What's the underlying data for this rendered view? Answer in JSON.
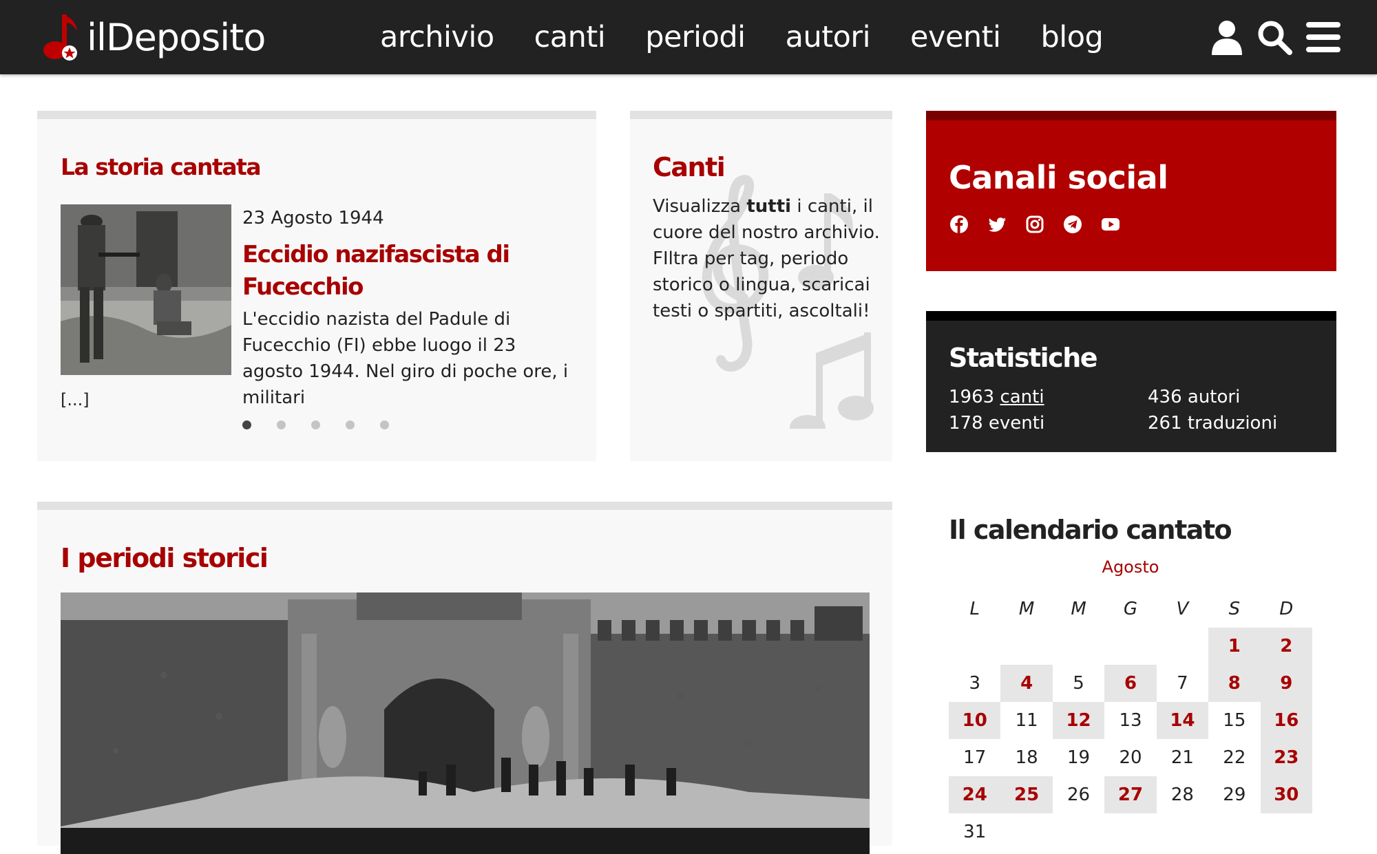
{
  "site": {
    "name": "ilDeposito"
  },
  "nav": {
    "links": [
      "archivio",
      "canti",
      "periodi",
      "autori",
      "eventi",
      "blog"
    ]
  },
  "storia": {
    "title": "La storia cantata",
    "date": "23 Agosto 1944",
    "heading": "Eccidio nazifascista di Fucecchio",
    "text": "L'eccidio nazista del Padule di Fucecchio (FI) ebbe luogo il 23 agosto 1944. Nel giro di poche ore, i militari",
    "more": "[...]",
    "slides": 5,
    "active_slide": 1
  },
  "canti": {
    "title": "Canti",
    "text_before": "Visualizza ",
    "text_bold": "tutti",
    "text_after": " i canti, il cuore del nostro archivio. FIltra per tag, periodo storico o lingua, scaricai testi o spartiti, ascoltali!"
  },
  "social": {
    "title": "Canali social",
    "icons": [
      "facebook-icon",
      "twitter-icon",
      "instagram-icon",
      "telegram-icon",
      "youtube-icon"
    ]
  },
  "stats": {
    "title": "Statistiche",
    "canti_count": "1963",
    "canti_label": "canti",
    "autori": "436 autori",
    "eventi": "178 eventi",
    "traduzioni": "261 traduzioni"
  },
  "periodi": {
    "title": "I periodi storici"
  },
  "calendar": {
    "title": "Il calendario cantato",
    "month": "Agosto",
    "weekdays": [
      "L",
      "M",
      "M",
      "G",
      "V",
      "S",
      "D"
    ],
    "first_weekday_index": 5,
    "days": 31,
    "highlighted": [
      1,
      2,
      4,
      6,
      8,
      9,
      10,
      12,
      14,
      16,
      23,
      24,
      25,
      27,
      30
    ]
  },
  "colors": {
    "accent": "#a80000",
    "navbar": "#222222",
    "social_bg": "#b00000"
  }
}
